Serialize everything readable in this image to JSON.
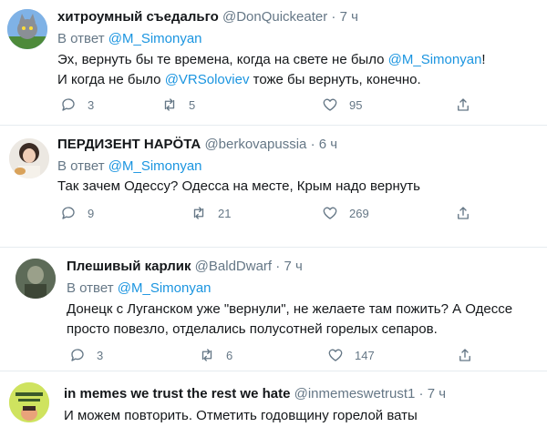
{
  "reply_prefix": "В ответ",
  "tweets": [
    {
      "name": "хитроумный съедальго",
      "handle": "@DonQuickeater",
      "time": "7 ч",
      "reply_to": "@M_Simonyan",
      "lines": [
        [
          "Эх, вернуть бы те времена, когда на свете не было ",
          "@M_Simonyan",
          "!"
        ],
        [
          "И когда не было ",
          "@VRSoloviev",
          " тоже бы вернуть, конечно."
        ]
      ],
      "replies": "3",
      "retweets": "5",
      "likes": "95"
    },
    {
      "name": "ПЕРДИЗЕНТ НАРÖТА",
      "handle": "@berkovapussia",
      "time": "6 ч",
      "reply_to": "@M_Simonyan",
      "lines": [
        [
          "Так зачем Одессу? Одесса на месте, Крым надо вернуть"
        ]
      ],
      "replies": "9",
      "retweets": "21",
      "likes": "269"
    },
    {
      "name": "Плешивый карлик",
      "handle": "@BaldDwarf",
      "time": "7 ч",
      "reply_to": "@M_Simonyan",
      "lines": [
        [
          "Донецк с Луганском уже \"вернули\", не желаете там пожить? А Одессе"
        ],
        [
          "просто повезло, отделались полусотней горелых сепаров."
        ]
      ],
      "replies": "3",
      "retweets": "6",
      "likes": "147"
    },
    {
      "name": "in memes we trust the rest we hate",
      "handle": "@inmemeswetrust1",
      "time": "7 ч",
      "lines": [
        [
          "И можем повторить. Отметить годовщину горелой ваты"
        ]
      ]
    }
  ],
  "colors": {
    "mention": "#1b95e0",
    "muted": "#657786",
    "text": "#14171a",
    "separator": "#e6ecf0"
  },
  "icons": [
    "reply-icon",
    "retweet-icon",
    "like-icon",
    "share-icon"
  ]
}
